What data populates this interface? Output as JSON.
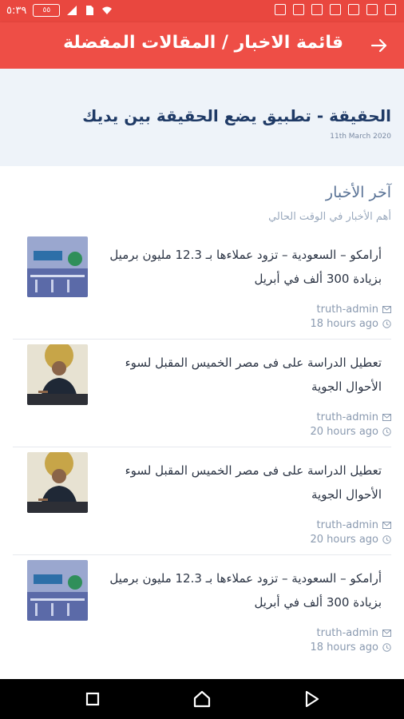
{
  "status_bar": {
    "time": "٥:٣٩",
    "battery": "٥٥",
    "icons": [
      "sim-icon",
      "signal-icon",
      "wifi-icon",
      "vibrate-icon",
      "notification-icon",
      "image-icon",
      "calendar-icon",
      "settings-icon",
      "chat-icon",
      "usb-icon"
    ]
  },
  "app_bar": {
    "title": "قائمة الاخبار / المقالات المفضلة",
    "back_icon": "arrow-forward-icon"
  },
  "hero": {
    "title": "الحقيقة - تطبيق يضع الحقيقة بين يديك",
    "date": "11th March 2020"
  },
  "section": {
    "title": "آخر الأخبار",
    "subtitle": "أهم الأخبار في الوقت الحالي"
  },
  "news": [
    {
      "title": "أرامكو – السعودية – تزود عملاءها بـ 12.3 مليون برميل بزيادة 300 ألف في أبريل",
      "author": "truth-admin",
      "time": "18 hours ago",
      "thumb": "aramco-image"
    },
    {
      "title": "تعطيل الدراسة على فى مصر الخميس المقبل لسوء الأحوال الجوية",
      "author": "truth-admin",
      "time": "20 hours ago",
      "thumb": "minister-image"
    },
    {
      "title": "تعطيل الدراسة على فى مصر الخميس المقبل لسوء الأحوال الجوية",
      "author": "truth-admin",
      "time": "20 hours ago",
      "thumb": "minister-image"
    },
    {
      "title": "أرامكو – السعودية – تزود عملاءها بـ 12.3 مليون برميل بزيادة 300 ألف في أبريل",
      "author": "truth-admin",
      "time": "18 hours ago",
      "thumb": "aramco-image"
    }
  ],
  "colors": {
    "app_bar": "#ee4e46",
    "status_bar": "#e9473f",
    "hero_bg": "#eef3f9",
    "hero_title": "#1f3a66"
  }
}
